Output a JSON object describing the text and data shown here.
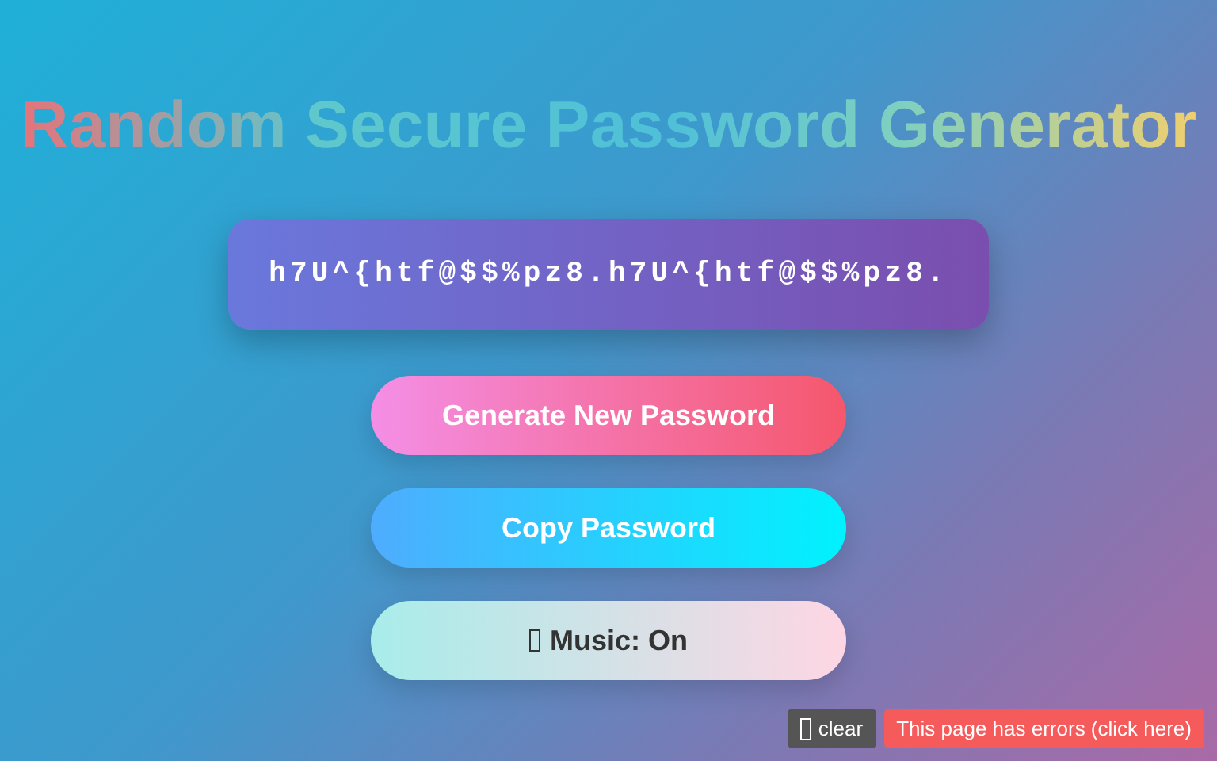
{
  "title": "Random Secure Password Generator",
  "password": "h7U^{htf@$$%pz8.h7U^{htf@$$%pz8.",
  "buttons": [
    {
      "kind": "generate",
      "label": "Generate New Password"
    },
    {
      "kind": "copy",
      "label": "Copy Password"
    },
    {
      "kind": "music",
      "label": "Music: On"
    }
  ],
  "error_bar": {
    "clear": "clear",
    "message": "This page has errors (click here)"
  }
}
